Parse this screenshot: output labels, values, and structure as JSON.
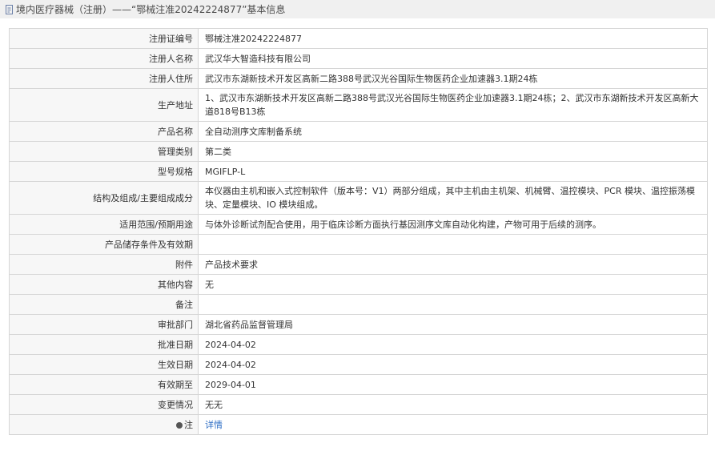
{
  "page": {
    "title": "境内医疗器械（注册）——“鄂械注准20242224877”基本信息"
  },
  "rows": [
    {
      "label": "注册证编号",
      "value": "鄂械注准20242224877"
    },
    {
      "label": "注册人名称",
      "value": "武汉华大智造科技有限公司"
    },
    {
      "label": "注册人住所",
      "value": "武汉市东湖新技术开发区高新二路388号武汉光谷国际生物医药企业加速器3.1期24栋"
    },
    {
      "label": "生产地址",
      "value": "1、武汉市东湖新技术开发区高新二路388号武汉光谷国际生物医药企业加速器3.1期24栋；2、武汉市东湖新技术开发区高新大道818号B13栋"
    },
    {
      "label": "产品名称",
      "value": "全自动测序文库制备系统"
    },
    {
      "label": "管理类别",
      "value": "第二类"
    },
    {
      "label": "型号规格",
      "value": "MGIFLP-L"
    },
    {
      "label": "结构及组成/主要组成成分",
      "value": "本仪器由主机和嵌入式控制软件（版本号：V1）两部分组成，其中主机由主机架、机械臂、温控模块、PCR 模块、温控振荡模块、定量模块、IO 模块组成。"
    },
    {
      "label": "适用范围/预期用途",
      "value": "与体外诊断试剂配合使用，用于临床诊断方面执行基因测序文库自动化构建，产物可用于后续的测序。"
    },
    {
      "label": "产品储存条件及有效期",
      "value": ""
    },
    {
      "label": "附件",
      "value": "产品技术要求"
    },
    {
      "label": "其他内容",
      "value": "无"
    },
    {
      "label": "备注",
      "value": ""
    },
    {
      "label": "审批部门",
      "value": "湖北省药品监督管理局"
    },
    {
      "label": "批准日期",
      "value": "2024-04-02"
    },
    {
      "label": "生效日期",
      "value": "2024-04-02"
    },
    {
      "label": "有效期至",
      "value": "2029-04-01"
    },
    {
      "label": "变更情况",
      "value": "无无"
    },
    {
      "label": "注",
      "value": "详情"
    }
  ]
}
